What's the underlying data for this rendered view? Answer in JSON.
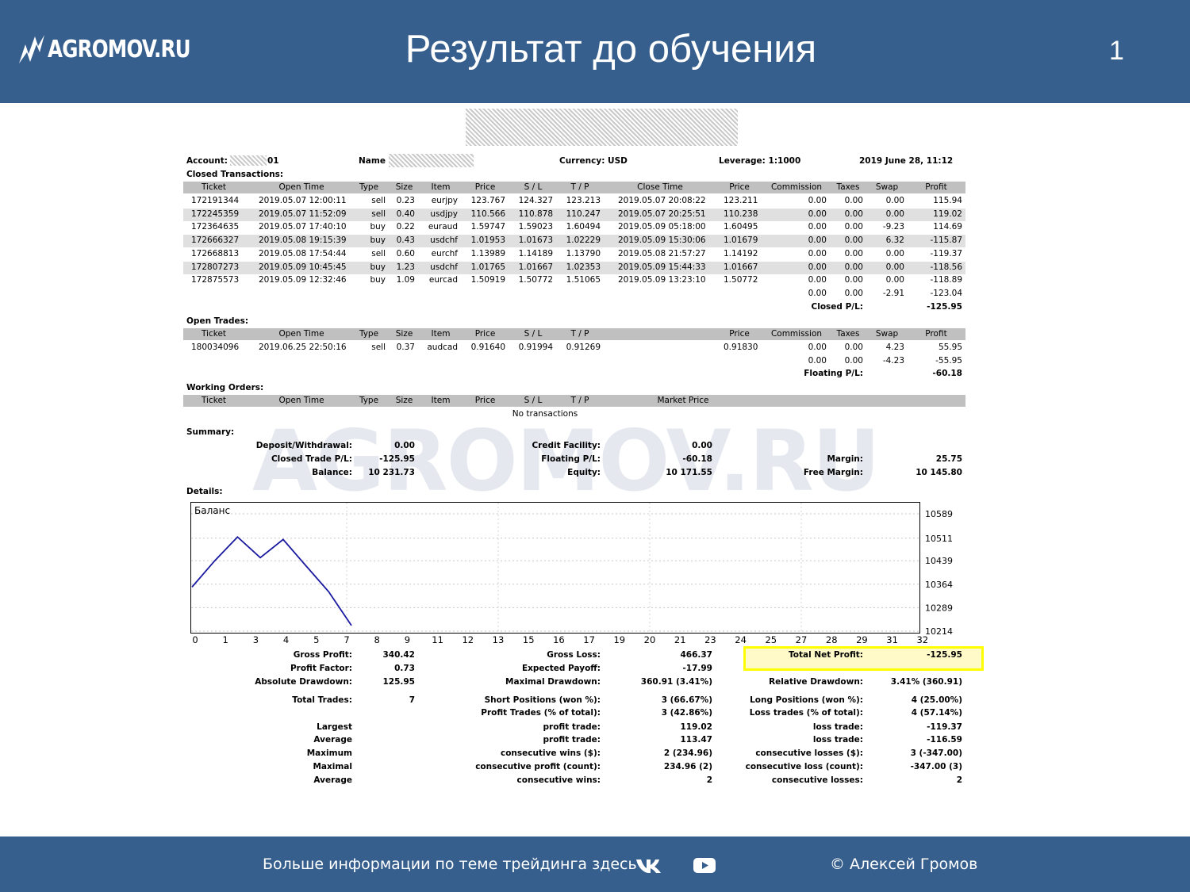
{
  "header": {
    "logo_text": "AGROMOV.RU",
    "title": "Результат до обучения",
    "slide_number": "1"
  },
  "account": {
    "account_label": "Account:",
    "account_value": "01",
    "name_label": "Name",
    "currency": "Currency: USD",
    "leverage": "Leverage: 1:1000",
    "datetime": "2019 June 28, 11:12"
  },
  "closed": {
    "title": "Closed Transactions:",
    "headers": [
      "Ticket",
      "Open Time",
      "Type",
      "Size",
      "Item",
      "Price",
      "S / L",
      "T / P",
      "Close Time",
      "Price",
      "Commission",
      "Taxes",
      "Swap",
      "Profit"
    ],
    "rows": [
      [
        "172191344",
        "2019.05.07 12:00:11",
        "sell",
        "0.23",
        "eurjpy",
        "123.767",
        "124.327",
        "123.213",
        "2019.05.07 20:08:22",
        "123.211",
        "0.00",
        "0.00",
        "0.00",
        "115.94"
      ],
      [
        "172245359",
        "2019.05.07 11:52:09",
        "sell",
        "0.40",
        "usdjpy",
        "110.566",
        "110.878",
        "110.247",
        "2019.05.07 20:25:51",
        "110.238",
        "0.00",
        "0.00",
        "0.00",
        "119.02"
      ],
      [
        "172364635",
        "2019.05.07 17:40:10",
        "buy",
        "0.22",
        "euraud",
        "1.59747",
        "1.59023",
        "1.60494",
        "2019.05.09 05:18:00",
        "1.60495",
        "0.00",
        "0.00",
        "-9.23",
        "114.69"
      ],
      [
        "172666327",
        "2019.05.08 19:15:39",
        "buy",
        "0.43",
        "usdchf",
        "1.01953",
        "1.01673",
        "1.02229",
        "2019.05.09 15:30:06",
        "1.01679",
        "0.00",
        "0.00",
        "6.32",
        "-115.87"
      ],
      [
        "172668813",
        "2019.05.08 17:54:44",
        "sell",
        "0.60",
        "eurchf",
        "1.13989",
        "1.14189",
        "1.13790",
        "2019.05.08 21:57:27",
        "1.14192",
        "0.00",
        "0.00",
        "0.00",
        "-119.37"
      ],
      [
        "172807273",
        "2019.05.09 10:45:45",
        "buy",
        "1.23",
        "usdchf",
        "1.01765",
        "1.01667",
        "1.02353",
        "2019.05.09 15:44:33",
        "1.01667",
        "0.00",
        "0.00",
        "0.00",
        "-118.56"
      ],
      [
        "172875573",
        "2019.05.09 12:32:46",
        "buy",
        "1.09",
        "eurcad",
        "1.50919",
        "1.50772",
        "1.51065",
        "2019.05.09 13:23:10",
        "1.50772",
        "0.00",
        "0.00",
        "0.00",
        "-118.89"
      ]
    ],
    "totals": [
      "0.00",
      "0.00",
      "-2.91",
      "-123.04"
    ],
    "pl_label": "Closed P/L:",
    "pl_value": "-125.95"
  },
  "open": {
    "title": "Open Trades:",
    "headers": [
      "Ticket",
      "Open Time",
      "Type",
      "Size",
      "Item",
      "Price",
      "S / L",
      "T / P",
      "Price",
      "Commission",
      "Taxes",
      "Swap",
      "Profit"
    ],
    "rows": [
      [
        "180034096",
        "2019.06.25 22:50:16",
        "sell",
        "0.37",
        "audcad",
        "0.91640",
        "0.91994",
        "0.91269",
        "0.91830",
        "0.00",
        "0.00",
        "4.23",
        "55.95"
      ]
    ],
    "totals": [
      "0.00",
      "0.00",
      "-4.23",
      "-55.95"
    ],
    "pl_label": "Floating P/L:",
    "pl_value": "-60.18"
  },
  "working": {
    "title": "Working Orders:",
    "headers": [
      "Ticket",
      "Open Time",
      "Type",
      "Size",
      "Item",
      "Price",
      "S / L",
      "T / P",
      "Market Price"
    ],
    "empty": "No transactions"
  },
  "summary": {
    "title": "Summary:",
    "deposit_label": "Deposit/Withdrawal:",
    "deposit_value": "0.00",
    "credit_label": "Credit Facility:",
    "credit_value": "0.00",
    "closed_label": "Closed Trade P/L:",
    "closed_value": "-125.95",
    "floating_label": "Floating P/L:",
    "floating_value": "-60.18",
    "margin_label": "Margin:",
    "margin_value": "25.75",
    "balance_label": "Balance:",
    "balance_value": "10 231.73",
    "equity_label": "Equity:",
    "equity_value": "10 171.55",
    "free_label": "Free Margin:",
    "free_value": "10 145.80"
  },
  "details_title": "Details:",
  "watermark": "AGROMOV.RU",
  "chart_data": {
    "type": "line",
    "title": "",
    "legend": "Баланс",
    "series": [
      {
        "name": "Баланс",
        "x": [
          0,
          1,
          2,
          3,
          4,
          5,
          6,
          7
        ],
        "values": [
          10355,
          10439,
          10515,
          10449,
          10507,
          10423,
          10340,
          10232
        ]
      }
    ],
    "x_ticks": [
      "0",
      "1",
      "3",
      "4",
      "5",
      "7",
      "8",
      "9",
      "11",
      "12",
      "13",
      "15",
      "16",
      "17",
      "19",
      "20",
      "21",
      "23",
      "24",
      "25",
      "27",
      "28",
      "29",
      "31",
      "32"
    ],
    "y_ticks": [
      "10589",
      "10511",
      "10439",
      "10364",
      "10289",
      "10214"
    ],
    "ylim": [
      10214,
      10589
    ],
    "grid": true,
    "color": "#1a1aa0"
  },
  "details": {
    "gross_profit_label": "Gross Profit:",
    "gross_profit_value": "340.42",
    "gross_loss_label": "Gross Loss:",
    "gross_loss_value": "466.37",
    "net_label": "Total Net Profit:",
    "net_value": "-125.95",
    "pf_label": "Profit Factor:",
    "pf_value": "0.73",
    "ep_label": "Expected Payoff:",
    "ep_value": "-17.99",
    "abs_dd_label": "Absolute Drawdown:",
    "abs_dd_value": "125.95",
    "max_dd_label": "Maximal Drawdown:",
    "max_dd_value": "360.91 (3.41%)",
    "rel_dd_label": "Relative Drawdown:",
    "rel_dd_value": "3.41% (360.91)",
    "tt_label": "Total Trades:",
    "tt_value": "7",
    "short_label": "Short Positions (won %):",
    "short_value": "3 (66.67%)",
    "long_label": "Long Positions (won %):",
    "long_value": "4 (25.00%)",
    "pt_label": "Profit Trades (% of total):",
    "pt_value": "3 (42.86%)",
    "lt_label": "Loss trades (% of total):",
    "lt_value": "4 (57.14%)",
    "largest": "Largest",
    "largest_pt_label": "profit trade:",
    "largest_pt_value": "119.02",
    "largest_lt_label": "loss trade:",
    "largest_lt_value": "-119.37",
    "average": "Average",
    "avg_pt_label": "profit trade:",
    "avg_pt_value": "113.47",
    "avg_lt_label": "loss trade:",
    "avg_lt_value": "-116.59",
    "maximum": "Maximum",
    "max_cw_label": "consecutive wins ($):",
    "max_cw_value": "2 (234.96)",
    "max_cl_label": "consecutive losses ($):",
    "max_cl_value": "3 (-347.00)",
    "maximal": "Maximal",
    "mx_cp_label": "consecutive profit (count):",
    "mx_cp_value": "234.96 (2)",
    "mx_cl_label": "consecutive loss (count):",
    "mx_cl_value": "-347.00 (3)",
    "average2": "Average",
    "av_cw_label": "consecutive wins:",
    "av_cw_value": "2",
    "av_cl_label": "consecutive losses:",
    "av_cl_value": "2"
  },
  "footer": {
    "text": "Больше информации по теме трейдинга здесь",
    "copyright": "© Алексей Громов"
  }
}
